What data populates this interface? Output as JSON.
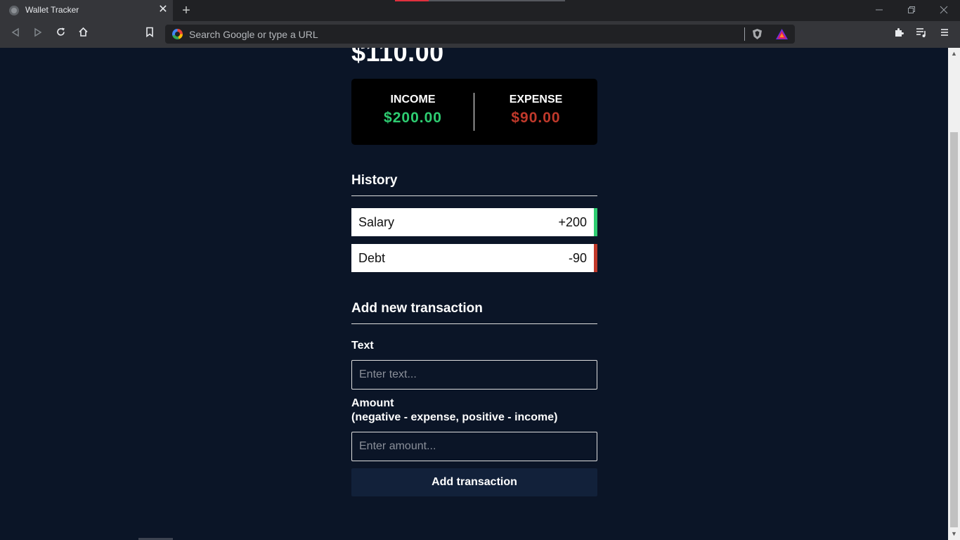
{
  "browser": {
    "tab_title": "Wallet Tracker",
    "tab_close_glyph": "✕",
    "new_tab_glyph": "+",
    "address_placeholder": "Search Google or type a URL",
    "icons": [
      "back-icon",
      "forward-icon",
      "reload-icon",
      "home-icon",
      "bookmark-icon",
      "google-icon",
      "brave-shield-icon",
      "brave-rewards-icon",
      "extensions-icon",
      "media-playlist-icon",
      "menu-icon",
      "minimize-icon",
      "restore-icon",
      "close-icon"
    ]
  },
  "app": {
    "balance": "$110.00",
    "income": {
      "label": "INCOME",
      "amount": "$200.00",
      "color": "#2ecc71"
    },
    "expense": {
      "label": "EXPENSE",
      "amount": "$90.00",
      "color": "#c0392b"
    },
    "history_title": "History",
    "transactions": [
      {
        "name": "Salary",
        "amount": "+200",
        "type": "plus"
      },
      {
        "name": "Debt",
        "amount": "-90",
        "type": "minus"
      }
    ],
    "form": {
      "title": "Add new transaction",
      "text_label": "Text",
      "text_placeholder": "Enter text...",
      "amount_label": "Amount",
      "amount_hint": "(negative - expense, positive - income)",
      "amount_placeholder": "Enter amount...",
      "submit_label": "Add transaction"
    }
  },
  "colors": {
    "page_background": "#0b1527",
    "card_background": "#000000",
    "button_background": "#12213a",
    "chrome_dark": "#202124",
    "chrome_toolbar": "#35363a"
  }
}
